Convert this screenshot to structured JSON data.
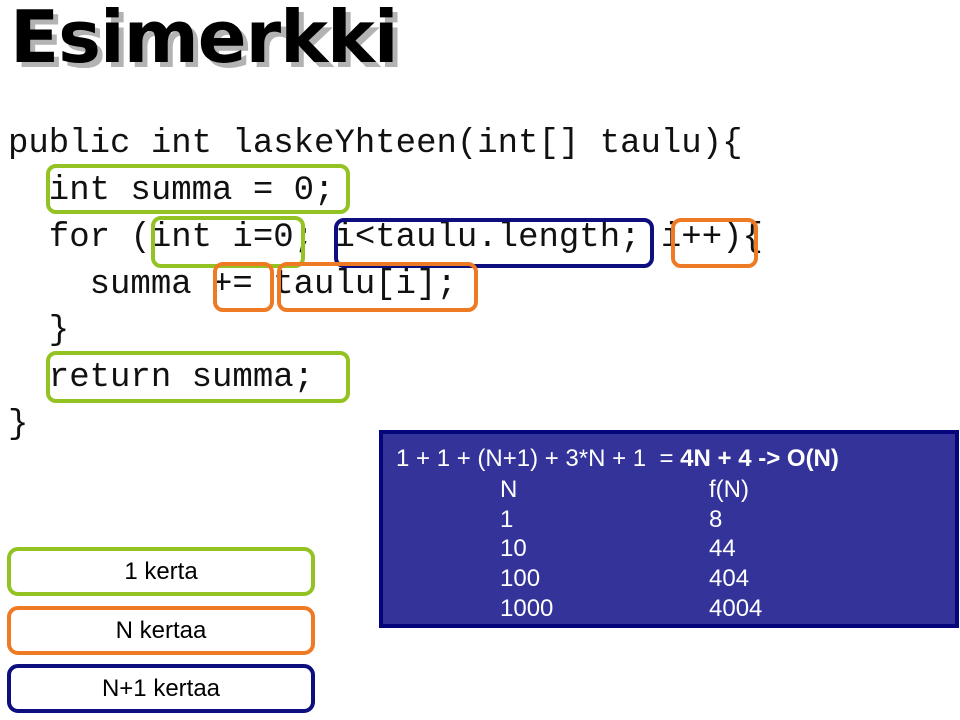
{
  "slide": {
    "title": "Esimerkki"
  },
  "code": {
    "lines": [
      "public int laskeYhteen(int[] taulu){",
      "  int summa = 0;",
      "  for (int i=0; i<taulu.length; i++){",
      "    summa += taulu[i];",
      "  }",
      "  return summa;",
      "}"
    ]
  },
  "highlights": {
    "colors": {
      "once": "#92c322",
      "n_times": "#ef7a24",
      "n_plus_one_times": "#0d0f7e"
    },
    "regions": [
      {
        "text": "int summa = 0;",
        "category": "once"
      },
      {
        "text": "int i=0",
        "category": "once"
      },
      {
        "text": "i<taulu.length",
        "category": "n_plus_one_times"
      },
      {
        "text": "i++",
        "category": "n_times"
      },
      {
        "text": "+=",
        "category": "n_times"
      },
      {
        "text": "taulu[i];",
        "category": "n_times"
      },
      {
        "text": "return summa;",
        "category": "once"
      }
    ]
  },
  "legend": {
    "items": [
      {
        "label": "1 kerta",
        "category": "once"
      },
      {
        "label": "N kertaa",
        "category": "n_times"
      },
      {
        "label": "N+1 kertaa",
        "category": "n_plus_one_times"
      }
    ]
  },
  "analysis": {
    "formula_left": "1 + 1 + (N+1) + 3*N + 1  = ",
    "formula_result": "4N + 4 -> O(N)",
    "table": {
      "headers": [
        "N",
        "f(N)"
      ],
      "rows": [
        [
          "1",
          "8"
        ],
        [
          "10",
          "44"
        ],
        [
          "100",
          "404"
        ],
        [
          "1000",
          "4004"
        ]
      ]
    },
    "colors": {
      "background": "#333399",
      "border": "#06067c",
      "text": "#ffffff"
    }
  }
}
